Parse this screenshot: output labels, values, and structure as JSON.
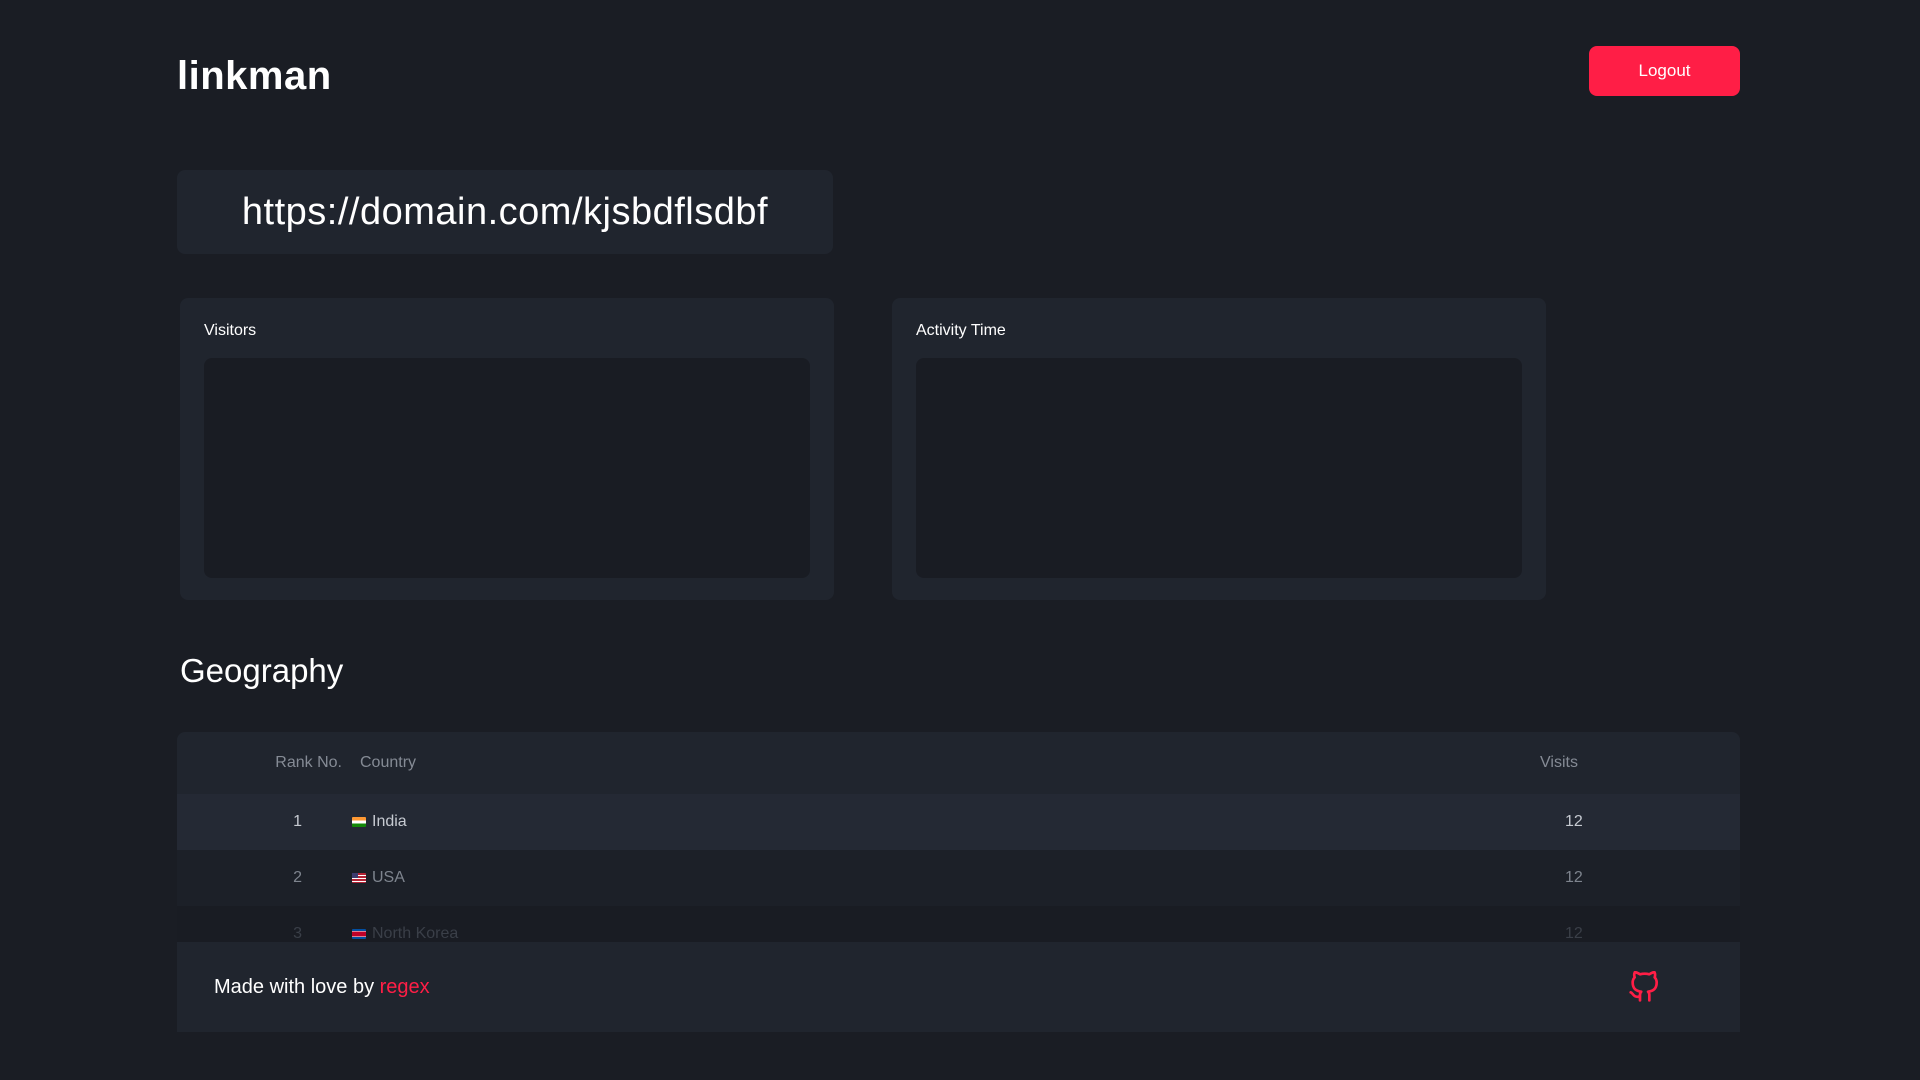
{
  "header": {
    "brand": "linkman",
    "logout_label": "Logout"
  },
  "short_url": "https://domain.com/kjsbdflsdbf",
  "cards": {
    "visitors_title": "Visitors",
    "activity_title": "Activity Time"
  },
  "geography": {
    "title": "Geography",
    "columns": {
      "rank": "Rank No.",
      "country": "Country",
      "visits": "Visits"
    },
    "rows": [
      {
        "rank": "1",
        "country": "India",
        "flag": "india-flag",
        "visits": "12"
      },
      {
        "rank": "2",
        "country": "USA",
        "flag": "usa-flag",
        "visits": "12"
      },
      {
        "rank": "3",
        "country": "North Korea",
        "flag": "north-korea-flag",
        "visits": "12"
      }
    ]
  },
  "footer": {
    "text": "Made with love by",
    "author": "regex",
    "icon": "github-icon"
  },
  "colors": {
    "background": "#1a1d24",
    "panel": "#20252e",
    "accent": "#ff1e46"
  }
}
